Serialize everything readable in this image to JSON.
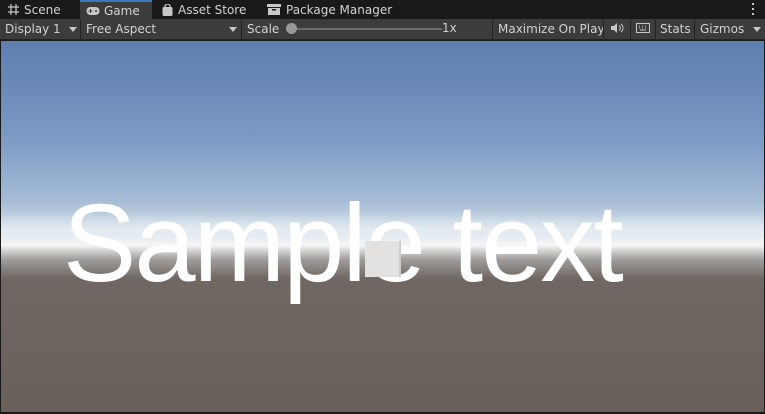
{
  "tabs": [
    {
      "label": "Scene",
      "icon": "grid-icon"
    },
    {
      "label": "Game",
      "icon": "gamepad-icon"
    },
    {
      "label": "Asset Store",
      "icon": "bag-icon"
    },
    {
      "label": "Package Manager",
      "icon": "box-icon"
    }
  ],
  "active_tab": "Game",
  "toolbar": {
    "display": "Display 1",
    "aspect": "Free Aspect",
    "scale_label": "Scale",
    "scale_value": "1x",
    "maximize": "Maximize On Play",
    "mute_icon": "speaker-icon",
    "keyboard_icon": "keyboard-icon",
    "stats": "Stats",
    "gizmos": "Gizmos"
  },
  "scene": {
    "text": "Sample text"
  },
  "colors": {
    "panel": "#3c3c3c",
    "active_tab_accent": "#3a79bb",
    "sky_top": "#5e7fb0",
    "ground": "#69605a"
  }
}
